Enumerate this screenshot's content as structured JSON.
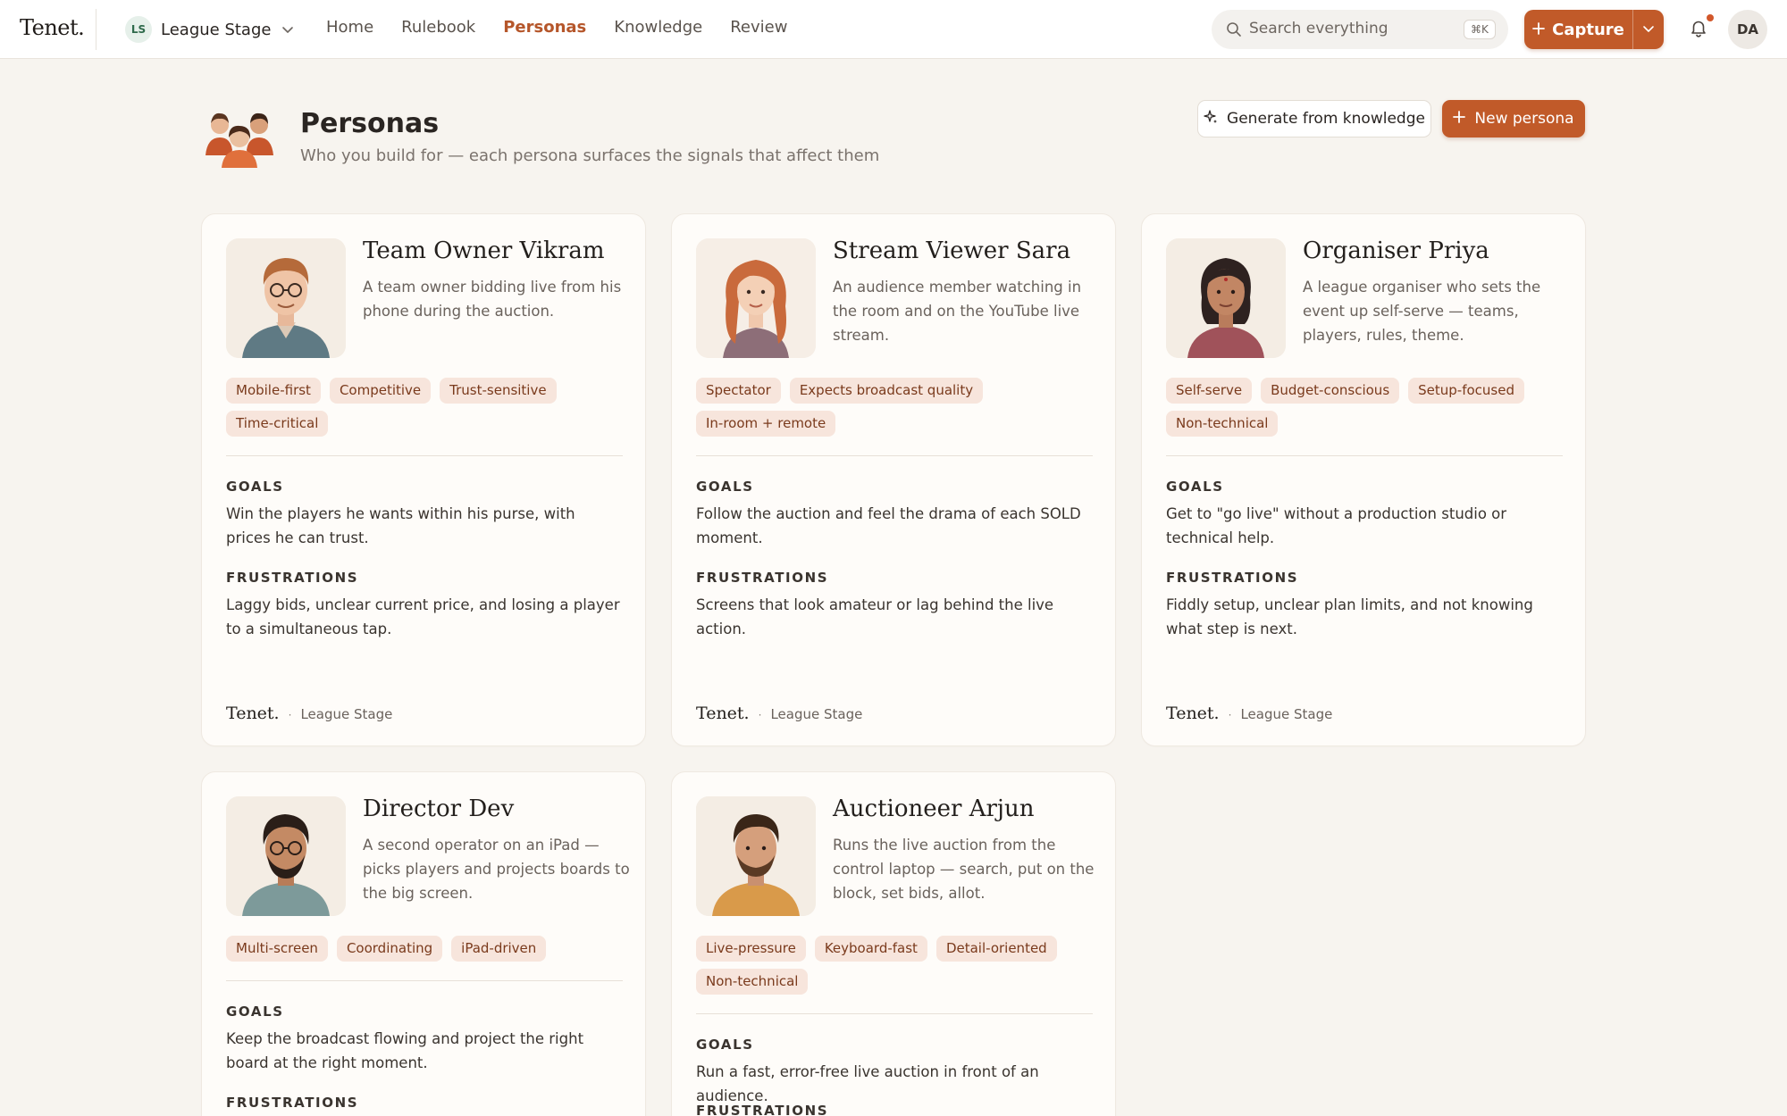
{
  "app": {
    "brand": "Tenet."
  },
  "workspace": {
    "initials": "LS",
    "name": "League Stage"
  },
  "nav": [
    {
      "label": "Home",
      "active": false
    },
    {
      "label": "Rulebook",
      "active": false
    },
    {
      "label": "Personas",
      "active": true
    },
    {
      "label": "Knowledge",
      "active": false
    },
    {
      "label": "Review",
      "active": false
    }
  ],
  "search": {
    "placeholder": "Search everything",
    "shortcut": "⌘K"
  },
  "capture": {
    "label": "Capture"
  },
  "user": {
    "initials": "DA"
  },
  "colors": {
    "accent": "#c15a29",
    "tag_bg": "#f7e5dc",
    "tag_text": "#7a3a1c",
    "page_bg": "#f7f4ef"
  },
  "page": {
    "title": "Personas",
    "subtitle": "Who you build for — each persona surfaces the signals that affect them",
    "generate_label": "Generate from knowledge",
    "new_label": "New persona"
  },
  "labels": {
    "goals": "GOALS",
    "frustrations": "FRUSTRATIONS"
  },
  "personas": [
    {
      "name": "Team Owner Vikram",
      "description": "A team owner bidding live from his phone during the auction.",
      "tags": [
        "Mobile-first",
        "Competitive",
        "Trust-sensitive",
        "Time-critical"
      ],
      "goals": "Win the players he wants within his purse, with prices he can trust.",
      "frustrations": "Laggy bids, unclear current price, and losing a player to a simultaneous tap.",
      "footer_brand": "Tenet.",
      "footer_workspace": "League Stage"
    },
    {
      "name": "Stream Viewer Sara",
      "description": "An audience member watching in the room and on the YouTube live stream.",
      "tags": [
        "Spectator",
        "Expects broadcast quality",
        "In-room + remote"
      ],
      "goals": "Follow the auction and feel the drama of each SOLD moment.",
      "frustrations": "Screens that look amateur or lag behind the live action.",
      "footer_brand": "Tenet.",
      "footer_workspace": "League Stage"
    },
    {
      "name": "Organiser Priya",
      "description": "A league organiser who sets the event up self-serve — teams, players, rules, theme.",
      "tags": [
        "Self-serve",
        "Budget-conscious",
        "Setup-focused",
        "Non-technical"
      ],
      "goals": "Get to \"go live\" without a production studio or technical help.",
      "frustrations": "Fiddly setup, unclear plan limits, and not knowing what step is next.",
      "footer_brand": "Tenet.",
      "footer_workspace": "League Stage"
    },
    {
      "name": "Director Dev",
      "description": "A second operator on an iPad — picks players and projects boards to the big screen.",
      "tags": [
        "Multi-screen",
        "Coordinating",
        "iPad-driven"
      ],
      "goals": "Keep the broadcast flowing and project the right board at the right moment.",
      "frustrations": "",
      "footer_brand": "",
      "footer_workspace": ""
    },
    {
      "name": "Auctioneer Arjun",
      "description": "Runs the live auction from the control laptop — search, put on the block, set bids, allot.",
      "tags": [
        "Live-pressure",
        "Keyboard-fast",
        "Detail-oriented",
        "Non-technical"
      ],
      "goals": "Run a fast, error-free live auction in front of an audience.",
      "frustrations": "",
      "footer_brand": "",
      "footer_workspace": ""
    }
  ]
}
